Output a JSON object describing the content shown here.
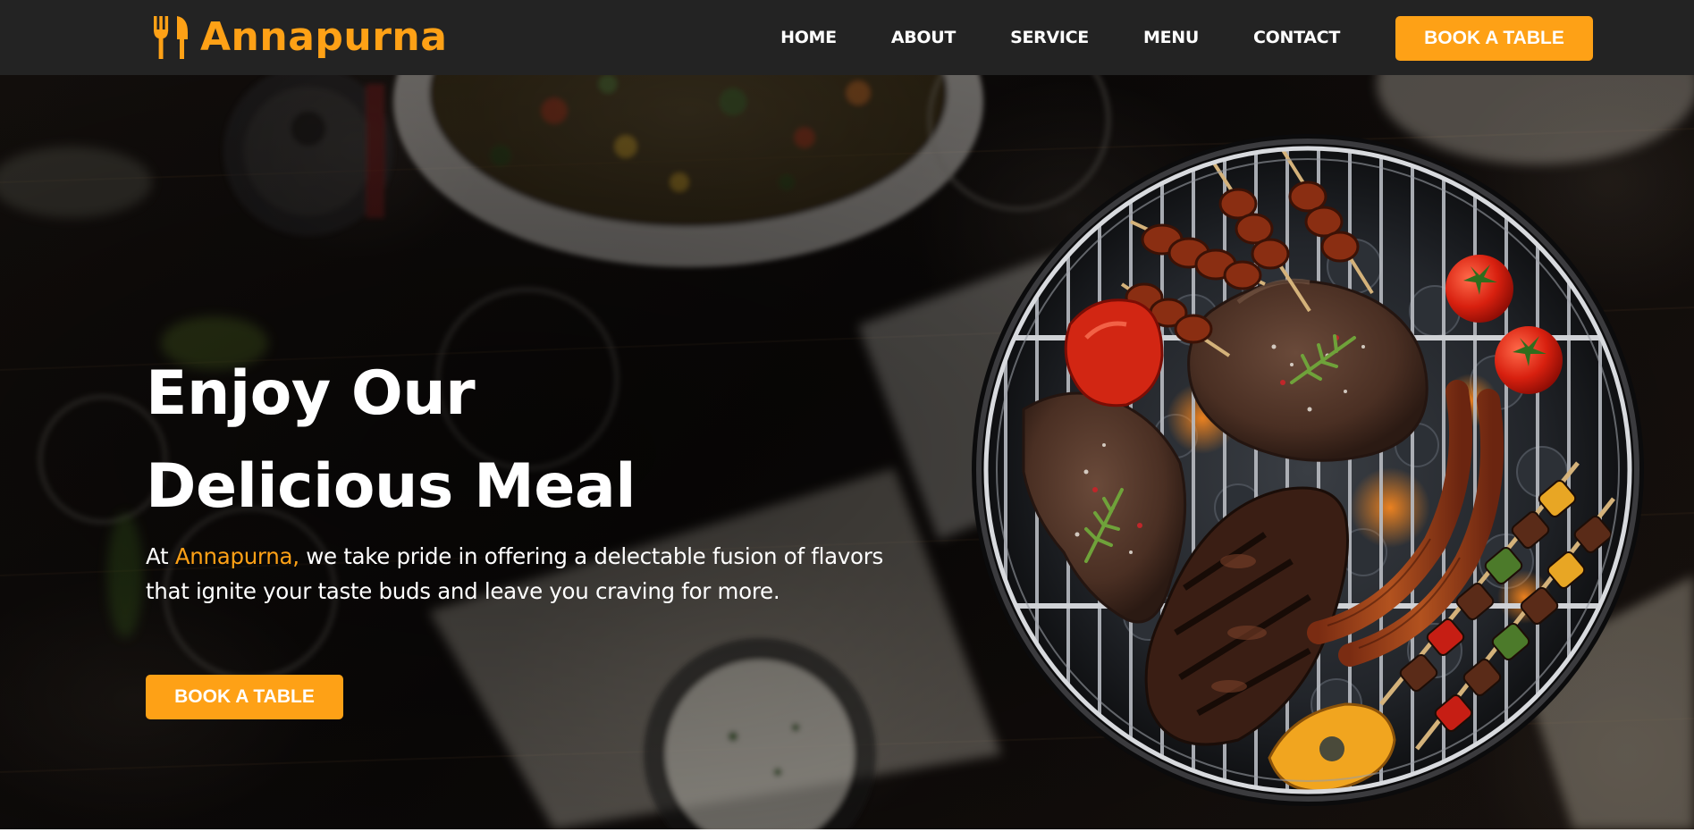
{
  "brand": {
    "name": "Annapurna",
    "icon": "utensils-icon",
    "color": "#FEA116"
  },
  "nav": {
    "items": [
      {
        "label": "HOME"
      },
      {
        "label": "ABOUT"
      },
      {
        "label": "SERVICE"
      },
      {
        "label": "MENU"
      },
      {
        "label": "CONTACT"
      }
    ],
    "cta_label": "BOOK A TABLE"
  },
  "hero": {
    "title_line1": "Enjoy Our",
    "title_line2": "Delicious Meal",
    "text_prefix": "At ",
    "text_accent": "Annapurna,",
    "text_suffix": " we take pride in offering a delectable fusion of flavors that ignite your taste buds and leave you craving for more.",
    "cta_label": "BOOK A TABLE",
    "image": "grilled-meat-barbecue-image"
  },
  "colors": {
    "accent": "#FEA116",
    "navbar": "#232323",
    "hero_bg": "#0f0c0a",
    "text": "#FFFFFF"
  }
}
